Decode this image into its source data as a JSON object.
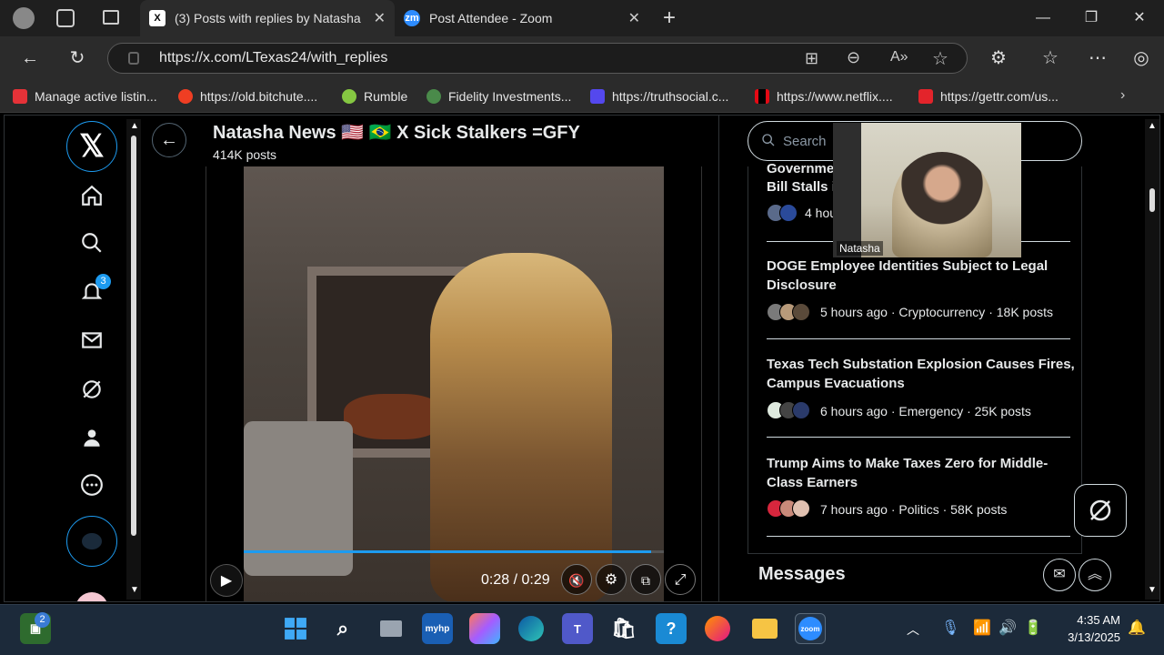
{
  "browser": {
    "tabs": [
      {
        "label": "(3) Posts with replies by Natasha",
        "favicon": "X"
      },
      {
        "label": "Post Attendee - Zoom",
        "favicon": "zm"
      }
    ],
    "url": "https://x.com/LTexas24/with_replies"
  },
  "bookmarks": [
    {
      "label": "Manage active listin...",
      "color": "#e53238"
    },
    {
      "label": "https://old.bitchute....",
      "color": "#ef3e23"
    },
    {
      "label": "Rumble",
      "color": "#85c742"
    },
    {
      "label": "Fidelity Investments...",
      "color": "#4a8a4a"
    },
    {
      "label": "https://truthsocial.c...",
      "color": "#5448ee"
    },
    {
      "label": "https://www.netflix....",
      "color": "#e50914"
    },
    {
      "label": "https://gettr.com/us...",
      "color": "#e3242b"
    }
  ],
  "profile": {
    "name": "Natasha News 🇺🇸 🇧🇷 X Sick Stalkers =GFY",
    "posts": "414K posts"
  },
  "nav": {
    "notif_count": "3"
  },
  "video": {
    "time": "0:28 / 0:29",
    "progress": 0.97
  },
  "search": {
    "placeholder": "Search"
  },
  "zoom": {
    "participant": "Natasha"
  },
  "trends": [
    {
      "title_partial_1": "Governme",
      "title_partial_2": "Bill Stalls i",
      "meta": "4 hou"
    },
    {
      "title": "DOGE Employee Identities Subject to Legal Disclosure",
      "meta": "5 hours ago · Cryptocurrency · 18K posts"
    },
    {
      "title": "Texas Tech Substation Explosion Causes Fires, Campus Evacuations",
      "meta": "6 hours ago · Emergency · 25K posts"
    },
    {
      "title": "Trump Aims to Make Taxes Zero for Middle-Class Earners",
      "meta": "7 hours ago · Politics · 58K posts"
    }
  ],
  "messages": {
    "label": "Messages"
  },
  "taskbar": {
    "badge": "2",
    "time": "4:35 AM",
    "date": "3/13/2025"
  },
  "colors": {
    "accent": "#1d9bf0",
    "background": "#000000",
    "taskbar": "#1c2a3a"
  }
}
